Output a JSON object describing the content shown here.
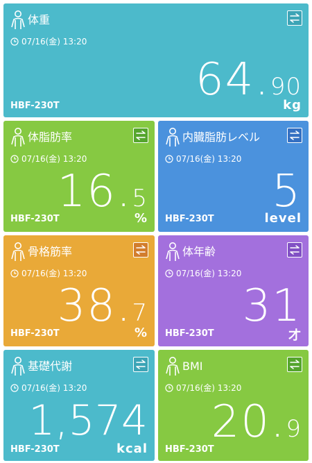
{
  "colors": {
    "weight": "#4cbacb",
    "body_fat": "#86c942",
    "visceral_fat": "#4b92dd",
    "skeletal_muscle": "#e9a938",
    "body_age": "#a370dd",
    "basal_metabolism": "#4cbacb",
    "bmi": "#86c942"
  },
  "icons": {
    "person": "person-icon",
    "swap": "swap-arrows-icon",
    "clock": "clock-icon"
  },
  "tiles": {
    "weight": {
      "title": "体重",
      "time": "07/16(金) 13:20",
      "value_int": "64.",
      "value_dec": "90",
      "unit": "kg",
      "model": "HBF-230T"
    },
    "body_fat": {
      "title": "体脂肪率",
      "time": "07/16(金) 13:20",
      "value_int": "16.",
      "value_dec": "5",
      "unit": "%",
      "model": "HBF-230T"
    },
    "visceral_fat": {
      "title": "内臓脂肪レベル",
      "time": "07/16(金) 13:20",
      "value_int": "5",
      "value_dec": "",
      "unit": "level",
      "model": "HBF-230T"
    },
    "skeletal_muscle": {
      "title": "骨格筋率",
      "time": "07/16(金) 13:20",
      "value_int": "38.",
      "value_dec": "7",
      "unit": "%",
      "model": "HBF-230T"
    },
    "body_age": {
      "title": "体年齢",
      "time": "07/16(金) 13:20",
      "value_int": "31",
      "value_dec": "",
      "unit": "才",
      "model": "HBF-230T"
    },
    "basal_metabolism": {
      "title": "基礎代謝",
      "time": "07/16(金) 13:20",
      "value_int": "1,574",
      "value_dec": "",
      "unit": "kcal",
      "model": "HBF-230T"
    },
    "bmi": {
      "title": "BMI",
      "time": "07/16(金) 13:20",
      "value_int": "20.",
      "value_dec": "9",
      "unit": "",
      "model": "HBF-230T"
    }
  }
}
